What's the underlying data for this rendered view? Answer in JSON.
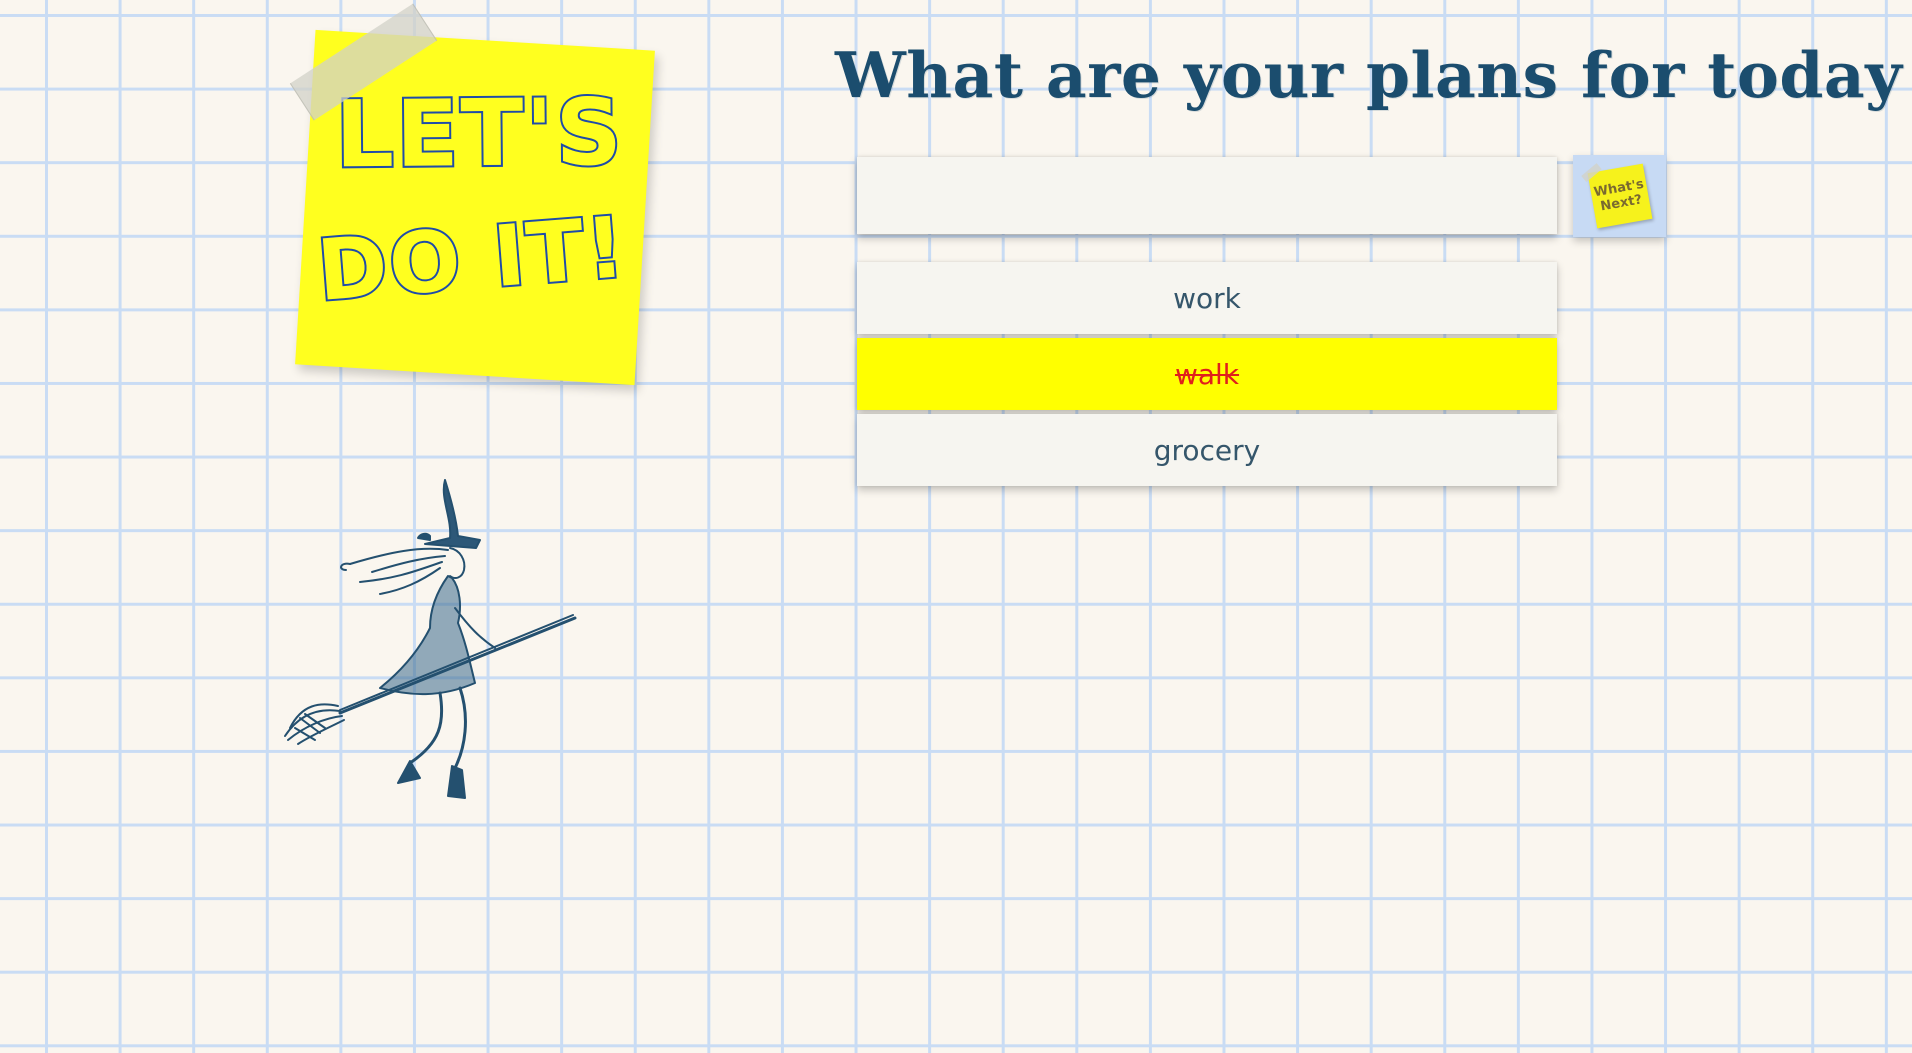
{
  "sticky_note": {
    "line1": "LET'S",
    "line2": "DO IT!"
  },
  "header": {
    "title": "What are your plans for today"
  },
  "new_task": {
    "value": "",
    "placeholder": ""
  },
  "next_button": {
    "label": "What's Next?"
  },
  "tasks": [
    {
      "text": "work",
      "done": false
    },
    {
      "text": "walk",
      "done": true
    },
    {
      "text": "grocery",
      "done": false
    }
  ],
  "colors": {
    "sticky": "#ffff1f",
    "sticky_ink": "#1f4ca8",
    "title": "#1b4d6e",
    "grid": "#c9dcf4",
    "done_highlight": "#ffff00",
    "done_text": "#e0201c"
  }
}
